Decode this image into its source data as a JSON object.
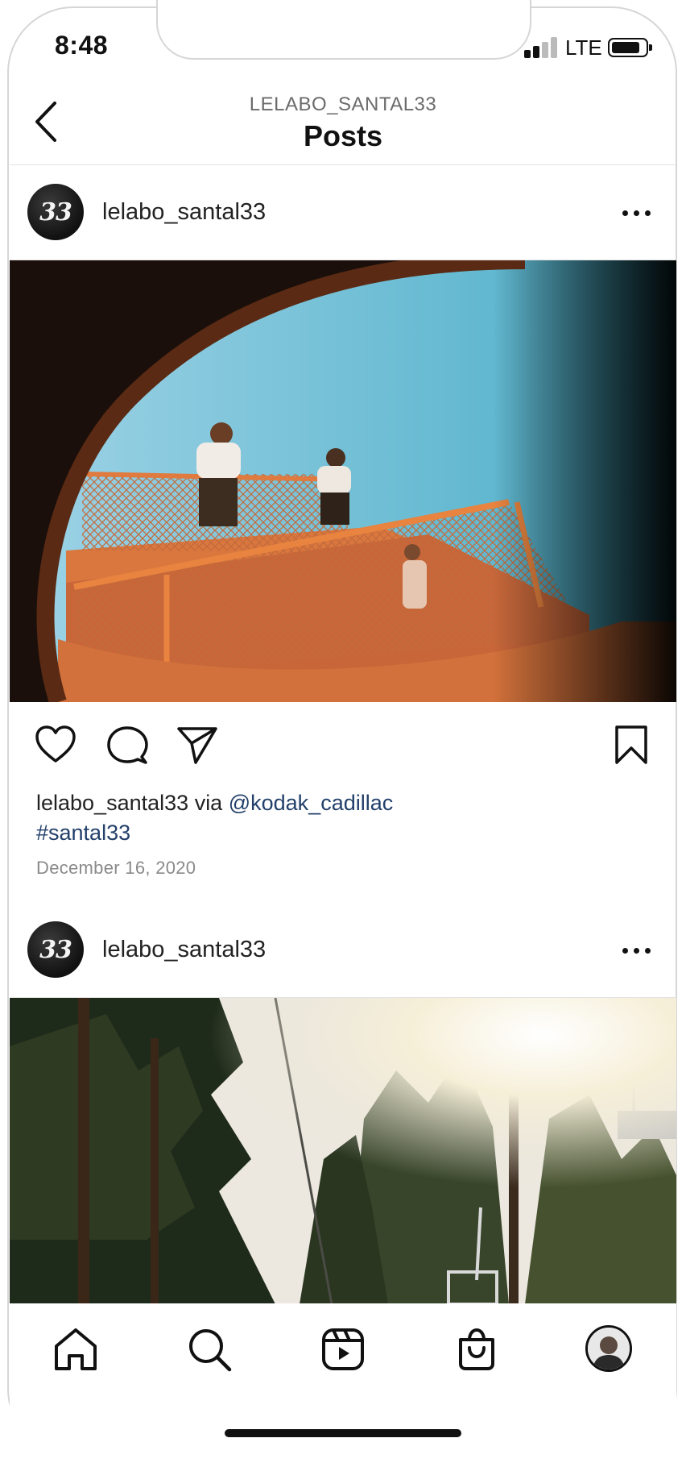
{
  "status_bar": {
    "time": "8:48",
    "network": "LTE",
    "signal_bars_filled": 2,
    "signal_bars_total": 4
  },
  "header": {
    "account_label": "LELABO_SANTAL33",
    "title": "Posts",
    "back_icon": "chevron-left-icon"
  },
  "posts": [
    {
      "avatar_text": "33",
      "username": "lelabo_santal33",
      "more_icon": "more-horizontal-icon",
      "image_description_icon": "photo",
      "actions": {
        "like_icon": "heart-icon",
        "comment_icon": "comment-icon",
        "share_icon": "send-icon",
        "save_icon": "bookmark-icon"
      },
      "caption_user": "lelabo_santal33",
      "caption_via": "via",
      "caption_mention": "@kodak_cadillac",
      "caption_hashtag": "#santal33",
      "date": "December 16, 2020"
    },
    {
      "avatar_text": "33",
      "username": "lelabo_santal33",
      "more_icon": "more-horizontal-icon"
    }
  ],
  "tab_bar": {
    "items": [
      "home-icon",
      "search-icon",
      "reels-icon",
      "shop-icon",
      "profile-avatar"
    ]
  },
  "colors": {
    "link": "#23406b",
    "muted": "#8a8a8a",
    "frame": "#d6d6d6"
  }
}
